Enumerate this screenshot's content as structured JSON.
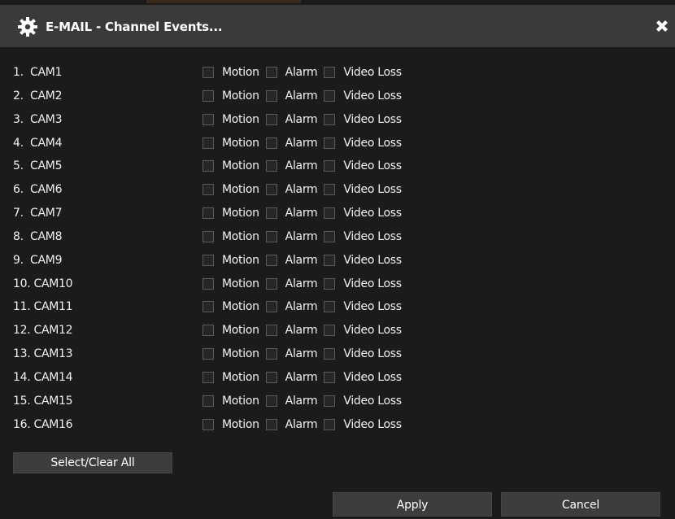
{
  "window": {
    "title": "E-MAIL - Channel Events..."
  },
  "channels": [
    {
      "label": "1.  CAM1"
    },
    {
      "label": "2.  CAM2"
    },
    {
      "label": "3.  CAM3"
    },
    {
      "label": "4.  CAM4"
    },
    {
      "label": "5.  CAM5"
    },
    {
      "label": "6.  CAM6"
    },
    {
      "label": "7.  CAM7"
    },
    {
      "label": "8.  CAM8"
    },
    {
      "label": "9.  CAM9"
    },
    {
      "label": "10. CAM10"
    },
    {
      "label": "11. CAM11"
    },
    {
      "label": "12. CAM12"
    },
    {
      "label": "13. CAM13"
    },
    {
      "label": "14. CAM14"
    },
    {
      "label": "15. CAM15"
    },
    {
      "label": "16. CAM16"
    }
  ],
  "event_options": {
    "motion": "Motion",
    "alarm": "Alarm",
    "video_loss": "Video Loss"
  },
  "buttons": {
    "select_clear_all": "Select/Clear All",
    "apply": "Apply",
    "cancel": "Cancel"
  },
  "icons": {
    "settings": "gear-icon",
    "close": "close-icon"
  },
  "colors": {
    "background": "#1b1b1b",
    "titlebar": "#3a3a3a",
    "button": "#3d3d3d",
    "text": "#f0f0f0"
  }
}
